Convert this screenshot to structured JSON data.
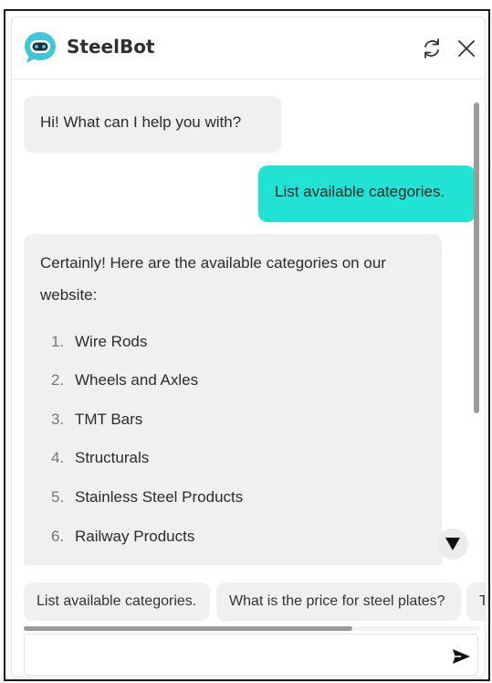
{
  "header": {
    "title": "SteelBot",
    "refresh_icon": "refresh-icon",
    "close_icon": "close-icon",
    "logo_icon": "robot-chat-icon"
  },
  "messages": {
    "bot_greeting": "Hi! What can I help you with?",
    "user_message": "List available categories.",
    "bot_reply_intro": "Certainly! Here are the available categories on our website:",
    "categories": [
      {
        "num": "1.",
        "label": "Wire Rods"
      },
      {
        "num": "2.",
        "label": "Wheels and Axles"
      },
      {
        "num": "3.",
        "label": "TMT Bars"
      },
      {
        "num": "4.",
        "label": "Structurals"
      },
      {
        "num": "5.",
        "label": "Stainless Steel Products"
      },
      {
        "num": "6.",
        "label": "Railway Products"
      }
    ],
    "scroll_down_icon": "arrow-down-icon"
  },
  "suggestions": [
    {
      "label": "List available categories."
    },
    {
      "label": "What is the price for steel plates?"
    },
    {
      "label": "Te"
    }
  ],
  "input": {
    "value": "",
    "placeholder": "",
    "send_icon": "send-icon"
  },
  "colors": {
    "accent": "#21e3d3",
    "bubble_bot": "#f0f0f0",
    "logo": "#3fc7d8"
  }
}
